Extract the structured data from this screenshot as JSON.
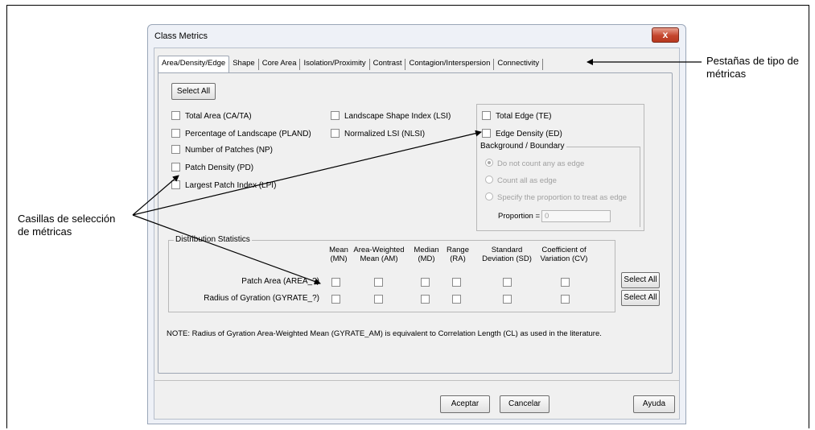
{
  "annotations": {
    "tabs_callout_line1": "Pestañas de tipo de",
    "tabs_callout_line2": "métricas",
    "checkbox_callout_line1": "Casillas de selección",
    "checkbox_callout_line2": "de métricas"
  },
  "window": {
    "title": "Class Metrics",
    "close_glyph": "x"
  },
  "tabs": [
    {
      "label": "Area/Density/Edge",
      "active": true
    },
    {
      "label": "Shape"
    },
    {
      "label": "Core Area"
    },
    {
      "label": "Isolation/Proximity"
    },
    {
      "label": "Contrast"
    },
    {
      "label": "Contagion/Interspersion"
    },
    {
      "label": "Connectivity"
    }
  ],
  "panel": {
    "select_all": "Select All",
    "col1": [
      "Total Area  (CA/TA)",
      "Percentage of Landscape  (PLAND)",
      "Number of Patches  (NP)",
      "Patch Density  (PD)",
      "Largest Patch Index  (LPI)"
    ],
    "col2": [
      "Landscape Shape Index  (LSI)",
      "Normalized LSI (NLSI)"
    ],
    "edge": {
      "total_edge": "Total Edge  (TE)",
      "edge_density": "Edge Density  (ED)",
      "group_label": "Background / Boundary",
      "radios": [
        "Do not count any as edge",
        "Count all as edge",
        "Specify the proportion to treat as edge"
      ],
      "proportion_label": "Proportion =",
      "proportion_value": "0"
    },
    "distribution": {
      "legend": "Distribution Statistics",
      "columns": [
        [
          "Mean",
          "(MN)"
        ],
        [
          "Area-Weighted",
          "Mean (AM)"
        ],
        [
          "Median",
          "(MD)"
        ],
        [
          "Range",
          "(RA)"
        ],
        [
          "Standard",
          "Deviation (SD)"
        ],
        [
          "Coefficient of",
          "Variation (CV)"
        ]
      ],
      "rows": [
        "Patch Area (AREA_?)",
        "Radius of Gyration (GYRATE_?)"
      ],
      "row_select_all": "Select All"
    },
    "note": "NOTE: Radius of Gyration Area-Weighted Mean (GYRATE_AM) is equivalent to Correlation Length (CL) as used in the literature."
  },
  "footer": {
    "accept": "Aceptar",
    "cancel": "Cancelar",
    "help": "Ayuda"
  }
}
